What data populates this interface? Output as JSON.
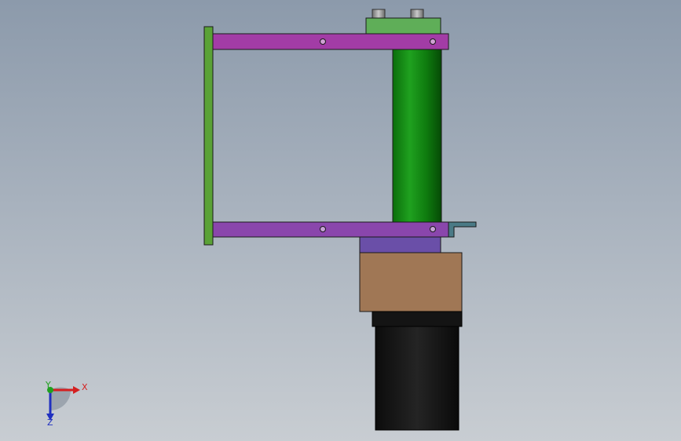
{
  "viewport": {
    "background_top": "#8c9aab",
    "background_bottom": "#c8cdd2"
  },
  "model": {
    "colors": {
      "left_plate": "#5aa236",
      "top_bar": "#a23ca6",
      "bottom_bar": "#8a46ac",
      "cylinder": "#1f9c1f",
      "top_block": "#5fae58",
      "adapter_plate": "#6a4fa8",
      "bracket": "#4a7a86",
      "gearbox": "#a07755",
      "motor": "#1a1a1a"
    }
  },
  "triad": {
    "x_label": "X",
    "y_label": "Y",
    "z_label": "Z",
    "x_color": "#d42020",
    "y_color": "#20a020",
    "z_color": "#2030c0"
  }
}
